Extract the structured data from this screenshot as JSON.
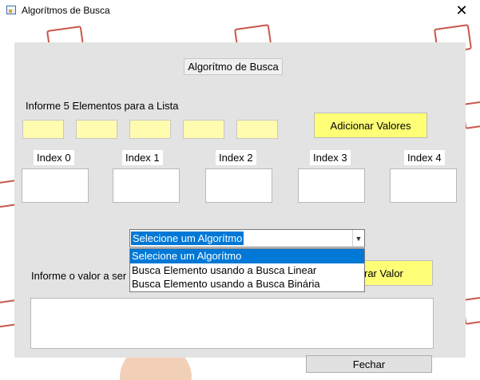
{
  "window": {
    "title": "Algorítmos de Busca",
    "close_glyph": "✕"
  },
  "group": {
    "title": "Algorítmo de Busca"
  },
  "list_prompt": "Informe 5 Elementos para a Lista",
  "add_button": "Adicionar Valores",
  "index_labels": [
    "Index 0",
    "Index 1",
    "Index 2",
    "Index 3",
    "Index 4"
  ],
  "search_prompt": "Informe o valor a ser",
  "search_button": "rar Valor",
  "algorithm_select": {
    "selected": "Selecione um Algorítmo",
    "options": [
      "Selecione um Algorítmo",
      "Busca Elemento usando a Busca Linear",
      "Busca Elemento usando a Busca Binária"
    ]
  },
  "close_button": "Fechar",
  "colors": {
    "input_yellow": "#fffcb0",
    "button_yellow": "#ffff77",
    "selection_blue": "#0078d7",
    "panel_gray": "#e3e3e3"
  }
}
